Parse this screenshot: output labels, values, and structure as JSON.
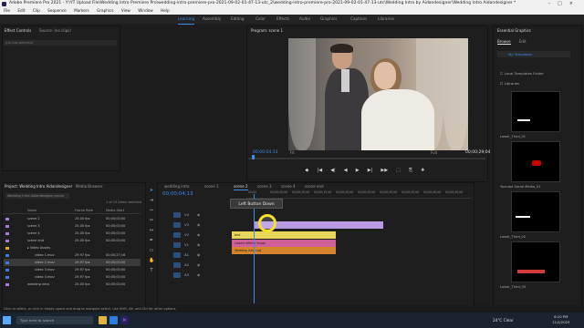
{
  "title": "Adobe Premiere Pro 2021 - Y:\\YT Upload File\\Wedding Intro Premiere Pro\\wedding-intro-premiere-pro-2021-09-02-01-47-13-utc_2\\wedding-intro-premiere-pro-2021-09-02-01-47-13-utc\\Wedding Intro by Aidandesigner\\Wedding Intro Aidandesigner *",
  "menu": [
    "File",
    "Edit",
    "Clip",
    "Sequence",
    "Markers",
    "Graphics",
    "View",
    "Window",
    "Help"
  ],
  "workspaces": [
    "Learning",
    "Assembly",
    "Editing",
    "Color",
    "Effects",
    "Audio",
    "Graphics",
    "Captions",
    "Libraries"
  ],
  "source_tabs": [
    "Effect Controls",
    "Source: (no clips)"
  ],
  "effects_empty": "(no clip selected)",
  "program": {
    "label": "Program: scene 1",
    "tc_left": "00;00;04;13",
    "fit": "Fit",
    "full": "Full",
    "tc_right": "00;00;29;04"
  },
  "transport": [
    "◆",
    "|◀",
    "◀|",
    "◀",
    "▶",
    "▶|",
    "▶▶",
    "⬚",
    "⎘",
    "✚"
  ],
  "project": {
    "tabs": [
      "Project: Wedding Intro Aidandesigner",
      "Media Browser"
    ],
    "search": "Wedding Intro Aidandesigner.prproj",
    "count": "1 of 13 items selected",
    "columns": [
      "Name",
      "Frame Rate",
      "Media Start"
    ],
    "rows": [
      {
        "name": "scene 2",
        "rate": "25.00 fps",
        "start": "00;00;00;00",
        "color": "#a77fd6"
      },
      {
        "name": "scene 3",
        "rate": "25.00 fps",
        "start": "00;00;00;00",
        "color": "#a77fd6"
      },
      {
        "name": "scene 4",
        "rate": "25.00 fps",
        "start": "00;00;00;00",
        "color": "#a77fd6"
      },
      {
        "name": "scene end",
        "rate": "25.00 fps",
        "start": "00;00;00;00",
        "color": "#a77fd6"
      },
      {
        "name": "Video Assets",
        "rate": "",
        "start": "",
        "color": "#e0a93a"
      },
      {
        "name": "video 1.mov",
        "rate": "29.97 fps",
        "start": "00;00;27;16",
        "color": "#3d7bd6"
      },
      {
        "name": "video 2.mov",
        "rate": "29.97 fps",
        "start": "00;00;00;00",
        "color": "#3d7bd6"
      },
      {
        "name": "video 3.mov",
        "rate": "29.97 fps",
        "start": "00;00;00;00",
        "color": "#3d7bd6"
      },
      {
        "name": "video 4.mov",
        "rate": "29.97 fps",
        "start": "00;00;00;00",
        "color": "#3d7bd6"
      },
      {
        "name": "wedding intro",
        "rate": "25.00 fps",
        "start": "00;00;00;00",
        "color": "#a77fd6"
      }
    ]
  },
  "timeline": {
    "tabs": [
      "wedding intro",
      "scene 1",
      "scene 2",
      "scene 3",
      "scene 4",
      "scene end"
    ],
    "timecode": "00;00;04;13",
    "ruler": [
      "00;00",
      "00;00;05;00",
      "00;00;10;00",
      "00;00;15;00",
      "00;00;20;00",
      "00;00;25;00",
      "00;00;30;00",
      "00;00;35;00",
      "00;00;40;00",
      "00;00;45;00"
    ],
    "tracks": [
      "V4",
      "V3",
      "V2",
      "V1",
      "A1",
      "A2",
      "A3"
    ],
    "clips": [
      {
        "label": "",
        "color": "#b89be2",
        "track": 1
      },
      {
        "label": "text",
        "color": "#e8d65a",
        "track": 2
      },
      {
        "label": "Lowers effects image",
        "color": "#d0609a",
        "track": 3
      },
      {
        "label": "Wedding Intro Log",
        "color": "#d5842e",
        "track": 4
      }
    ],
    "tooltip": "Left Button Down"
  },
  "essential_graphics": {
    "title": "Essential Graphics",
    "tabs": [
      "Browse",
      "Edit"
    ],
    "my_templates": "My Templates",
    "local": "Local Templates Folder",
    "libraries": "Libraries",
    "templates": [
      "Lower_Third_01",
      "Youtube Social Media_01",
      "Lower_Third_02",
      "Lower_Third_03"
    ]
  },
  "status": "Click to select, or click in empty space and drag to marquee select. Use Shift, Alt, and Ctrl for other options.",
  "taskbar": {
    "search": "Type here to search",
    "weather": "24°C Clear",
    "time": "6:10 PM",
    "date": "11/2/2023"
  },
  "colors": {
    "accent": "#3d8de8",
    "cursor": "#f5e02c"
  }
}
